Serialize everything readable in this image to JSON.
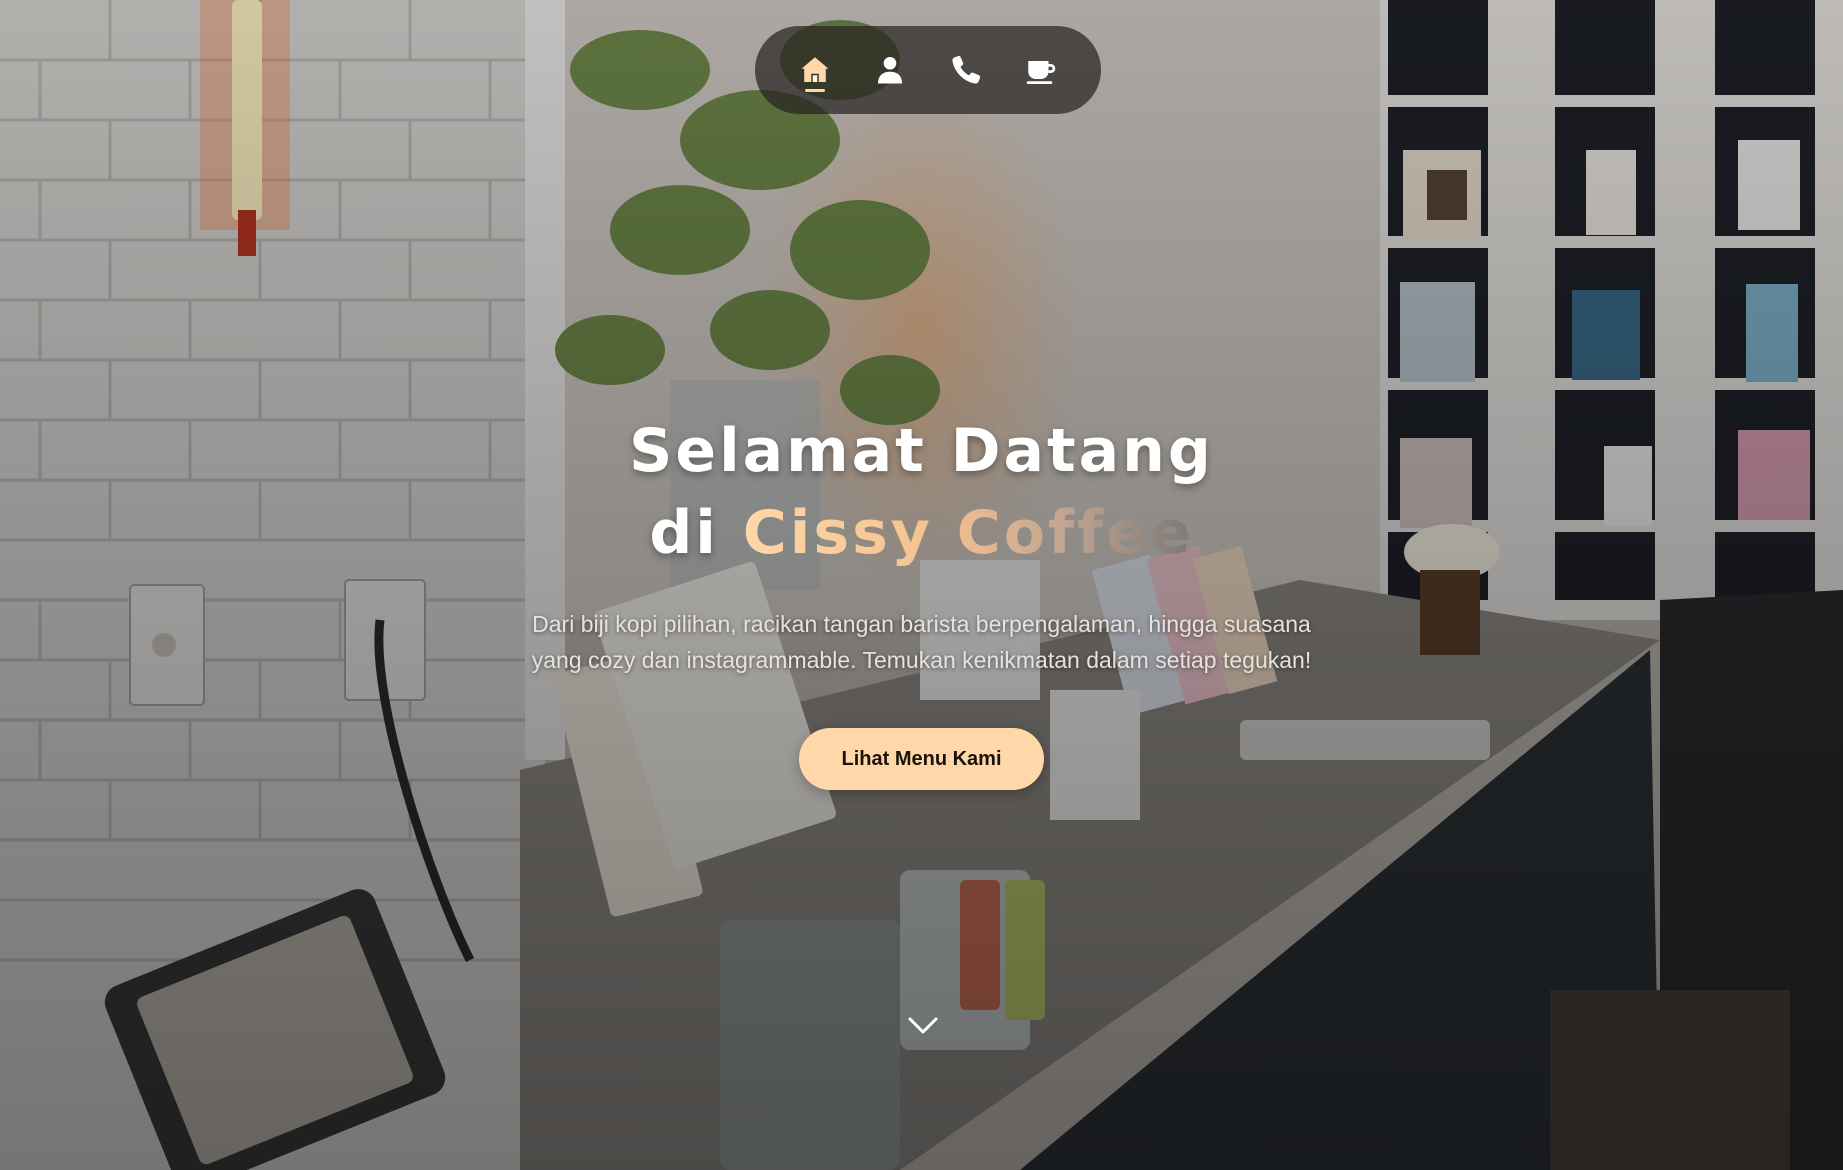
{
  "nav": {
    "items": [
      {
        "icon": "home-icon",
        "label": "Home",
        "active": true
      },
      {
        "icon": "user-icon",
        "label": "About",
        "active": false
      },
      {
        "icon": "phone-icon",
        "label": "Contact",
        "active": false
      },
      {
        "icon": "coffee-cup-icon",
        "label": "Menu",
        "active": false
      }
    ]
  },
  "hero": {
    "title_line1": "Selamat Datang",
    "title_prefix": "di",
    "brand_name": "Cissy Coffee",
    "subtitle_line1": "Dari biji kopi pilihan, racikan tangan barista berpengalaman, hingga suasana",
    "subtitle_line2": "yang cozy dan instagrammable. Temukan kenikmatan dalam setiap tegukan!",
    "cta_label": "Lihat Menu Kami",
    "scroll_icon": "chevron-down-icon"
  },
  "colors": {
    "accent": "#ffd7a8",
    "nav_bg": "rgba(40,36,34,0.72)",
    "icon": "#ffffff",
    "icon_active": "#ffd7a8"
  }
}
